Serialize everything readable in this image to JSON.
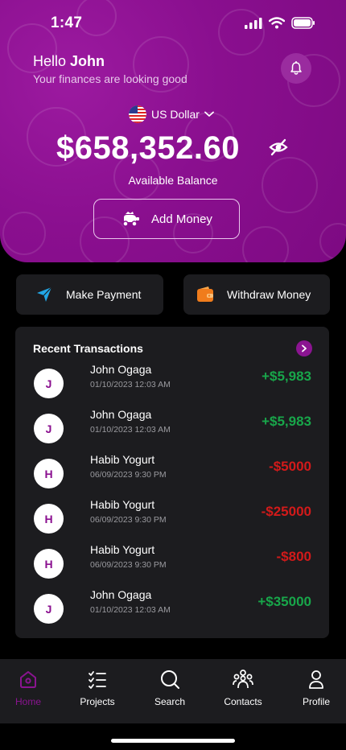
{
  "status": {
    "time": "1:47"
  },
  "header": {
    "greeting_prefix": "Hello",
    "user_name": "John",
    "subtitle": "Your finances are looking good"
  },
  "balance": {
    "currency": "US Dollar",
    "amount": "$658,352.60",
    "label": "Available Balance",
    "add_money_label": "Add Money"
  },
  "actions": {
    "pay_label": "Make Payment",
    "withdraw_label": "Withdraw Money"
  },
  "transactions": {
    "title": "Recent Transactions",
    "items": [
      {
        "initial": "J",
        "name": "John Ogaga",
        "date": "01/10/2023 12:03 AM",
        "amount": "+$5,983",
        "positive": true
      },
      {
        "initial": "J",
        "name": "John Ogaga",
        "date": "01/10/2023 12:03 AM",
        "amount": "+$5,983",
        "positive": true
      },
      {
        "initial": "H",
        "name": "Habib Yogurt",
        "date": "06/09/2023 9:30 PM",
        "amount": "-$5000",
        "positive": false
      },
      {
        "initial": "H",
        "name": "Habib Yogurt",
        "date": "06/09/2023 9:30 PM",
        "amount": "-$25000",
        "positive": false
      },
      {
        "initial": "H",
        "name": "Habib Yogurt",
        "date": "06/09/2023 9:30 PM",
        "amount": "-$800",
        "positive": false
      },
      {
        "initial": "J",
        "name": "John Ogaga",
        "date": "01/10/2023 12:03 AM",
        "amount": "+$35000",
        "positive": true
      }
    ]
  },
  "tabs": [
    {
      "label": "Home",
      "icon": "home-icon",
      "active": true
    },
    {
      "label": "Projects",
      "icon": "checklist-icon",
      "active": false
    },
    {
      "label": "Search",
      "icon": "search-icon",
      "active": false
    },
    {
      "label": "Contacts",
      "icon": "contacts-icon",
      "active": false
    },
    {
      "label": "Profile",
      "icon": "profile-icon",
      "active": false
    }
  ],
  "colors": {
    "brand": "#8a0f8f",
    "positive": "#18a64a",
    "negative": "#d21a1a",
    "card": "#1c1c1f"
  }
}
